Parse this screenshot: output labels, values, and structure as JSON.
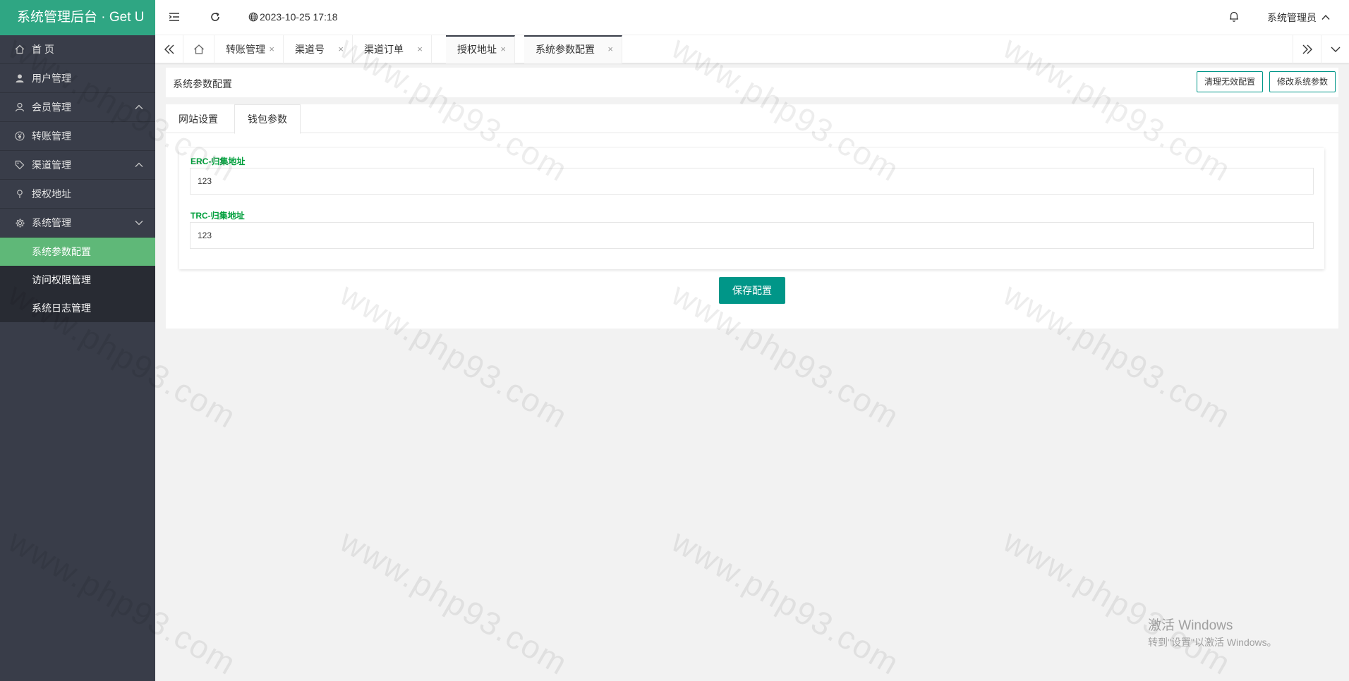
{
  "app": {
    "title": "系统管理后台 · Get U"
  },
  "sidebar": {
    "items": [
      {
        "label": "首 页",
        "icon": "home-icon"
      },
      {
        "label": "用户管理",
        "icon": "user-icon"
      },
      {
        "label": "会员管理",
        "icon": "member-icon",
        "arrow": "up"
      },
      {
        "label": "转账管理",
        "icon": "yen-icon"
      },
      {
        "label": "渠道管理",
        "icon": "tag-icon",
        "arrow": "up"
      },
      {
        "label": "授权地址",
        "icon": "location-pin-icon"
      },
      {
        "label": "系统管理",
        "icon": "gear-icon",
        "arrow": "down"
      }
    ],
    "subitems": [
      {
        "label": "系统参数配置",
        "active": true
      },
      {
        "label": "访问权限管理"
      },
      {
        "label": "系统日志管理"
      }
    ]
  },
  "header": {
    "datetime": "2023-10-25 17:18",
    "user": "系统管理员"
  },
  "tabs": [
    {
      "label": "转账管理"
    },
    {
      "label": "渠道号"
    },
    {
      "label": "渠道订单"
    },
    {
      "label": "授权地址"
    },
    {
      "label": "系统参数配置"
    }
  ],
  "tab_close": "×",
  "page": {
    "title": "系统参数配置",
    "buttons": {
      "clear": "清理无效配置",
      "modify": "修改系统参数"
    }
  },
  "form": {
    "tabs": [
      {
        "label": "网站设置"
      },
      {
        "label": "钱包参数"
      }
    ],
    "active_tab": "钱包参数",
    "fields": [
      {
        "label": "ERC-归集地址",
        "value": "123"
      },
      {
        "label": "TRC-归集地址",
        "value": "123"
      }
    ],
    "save_label": "保存配置"
  },
  "watermark": {
    "text": "www.php93.com",
    "activate_title": "激活 Windows",
    "activate_sub": "转到\"设置\"以激活 Windows。"
  },
  "colors": {
    "sidebar_bg": "#393d49",
    "logo_bg": "#2fa683",
    "active_menu": "#5fb878",
    "primary": "#009688",
    "label_green": "#009f3c"
  }
}
